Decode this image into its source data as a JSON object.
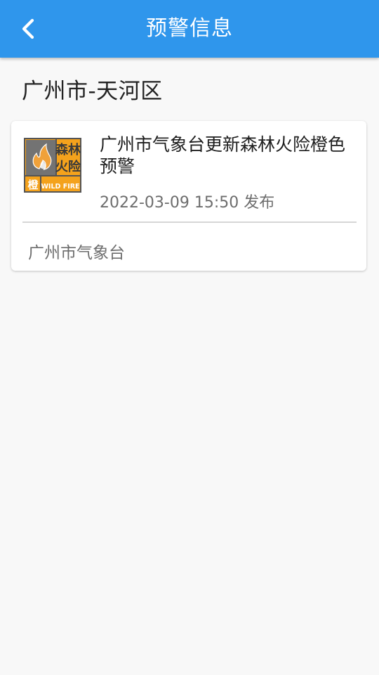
{
  "header": {
    "title": "预警信息",
    "back_icon": "chevron-left-icon"
  },
  "region": {
    "title": "广州市-天河区"
  },
  "warning": {
    "headline": "广州市气象台更新森林火险橙色预警",
    "time": "2022-03-09 15:50 发布",
    "source": "广州市气象台",
    "badge": {
      "icon": "forest-fire-warning-icon",
      "text_top": "森林",
      "text_mid": "火险",
      "level": "橙",
      "label": "WILD FIRE",
      "color": "#f4a21c"
    }
  },
  "colors": {
    "app_bar": "#2f96ec",
    "background": "#f8f8f8",
    "card": "#ffffff"
  }
}
